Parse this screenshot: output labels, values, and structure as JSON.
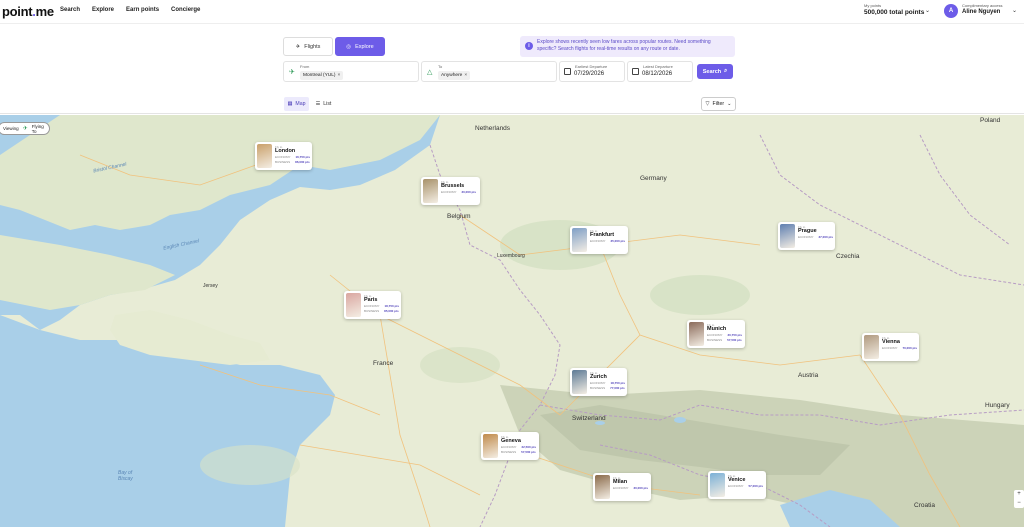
{
  "nav": {
    "logo_main": "point",
    "logo_dot": ".",
    "logo_suffix": "me",
    "links": [
      "Search",
      "Explore",
      "Earn points",
      "Concierge"
    ],
    "points_label": "My points",
    "points_value": "500,000 total points",
    "avatar_letter": "A",
    "account_label": "Complimentary access",
    "account_name": "Aline Nguyen"
  },
  "search": {
    "mode_flights": "Flights",
    "mode_explore": "Explore",
    "info_text": "Explore shows recently seen low fares across popular routes. Need something specific? Search flights for real-time results on any route or date.",
    "from_label": "From",
    "from_value": "Montreal (YUL)",
    "to_label": "To",
    "to_value": "Anywhere",
    "earliest_label": "Earliest Departure",
    "earliest_value": "07/29/2026",
    "latest_label": "Latest Departure",
    "latest_value": "08/12/2026",
    "search_button": "Search",
    "view_map": "Map",
    "view_list": "List",
    "filter": "Filter"
  },
  "map": {
    "viewing_label": "Viewing",
    "flying_to_label": "Flying To",
    "labels": {
      "netherlands": "Netherlands",
      "poland": "Poland",
      "germany": "Germany",
      "belgium": "Belgium",
      "luxembourg": "Luxembourg",
      "czechia": "Czechia",
      "france": "France",
      "austria": "Austria",
      "switzerland": "Switzerland",
      "hungary": "Hungary",
      "croatia": "Croatia",
      "jersey": "Jersey",
      "bristol_channel": "Bristol Channel",
      "english_channel": "English Channel",
      "bay_of_biscay": "Bay of Biscay"
    },
    "card_caption": "Fly to",
    "cards": [
      {
        "name": "London",
        "rows": [
          "ECONOMY",
          "BUSINESS"
        ],
        "prices": [
          "16,750 pts",
          "86,000 pts"
        ],
        "color": "#c9a06a"
      },
      {
        "name": "Brussels",
        "rows": [
          "ECONOMY"
        ],
        "prices": [
          "30,000 pts"
        ],
        "color": "#a8926a"
      },
      {
        "name": "Frankfurt",
        "rows": [
          "ECONOMY"
        ],
        "prices": [
          "35,000 pts"
        ],
        "color": "#7f9fc6"
      },
      {
        "name": "Prague",
        "rows": [
          "ECONOMY"
        ],
        "prices": [
          "37,000 pts"
        ],
        "color": "#5f7fb0"
      },
      {
        "name": "Paris",
        "rows": [
          "ECONOMY",
          "BUSINESS"
        ],
        "prices": [
          "18,750 pts",
          "85,000 pts"
        ],
        "color": "#d9a6a0"
      },
      {
        "name": "Munich",
        "rows": [
          "ECONOMY",
          "BUSINESS"
        ],
        "prices": [
          "30,750 pts",
          "57,500 pts"
        ],
        "color": "#8a6a5a"
      },
      {
        "name": "Vienna",
        "rows": [
          "ECONOMY"
        ],
        "prices": [
          "70,000 pts"
        ],
        "color": "#b09a80"
      },
      {
        "name": "Zurich",
        "rows": [
          "ECONOMY",
          "BUSINESS"
        ],
        "prices": [
          "18,750 pts",
          "77,000 pts"
        ],
        "color": "#5d7a96"
      },
      {
        "name": "Geneva",
        "rows": [
          "ECONOMY",
          "BUSINESS"
        ],
        "prices": [
          "22,500 pts",
          "57,500 pts"
        ],
        "color": "#c08a4a"
      },
      {
        "name": "Milan",
        "rows": [
          "ECONOMY"
        ],
        "prices": [
          "30,000 pts"
        ],
        "color": "#8a6a4a"
      },
      {
        "name": "Venice",
        "rows": [
          "ECONOMY"
        ],
        "prices": [
          "57,000 pts"
        ],
        "color": "#7ab0d6"
      }
    ]
  },
  "colors": {
    "accent": "#6d5ce8",
    "green": "#2e9a58",
    "land": "#e8ecd6",
    "water": "#a9cfe8"
  }
}
